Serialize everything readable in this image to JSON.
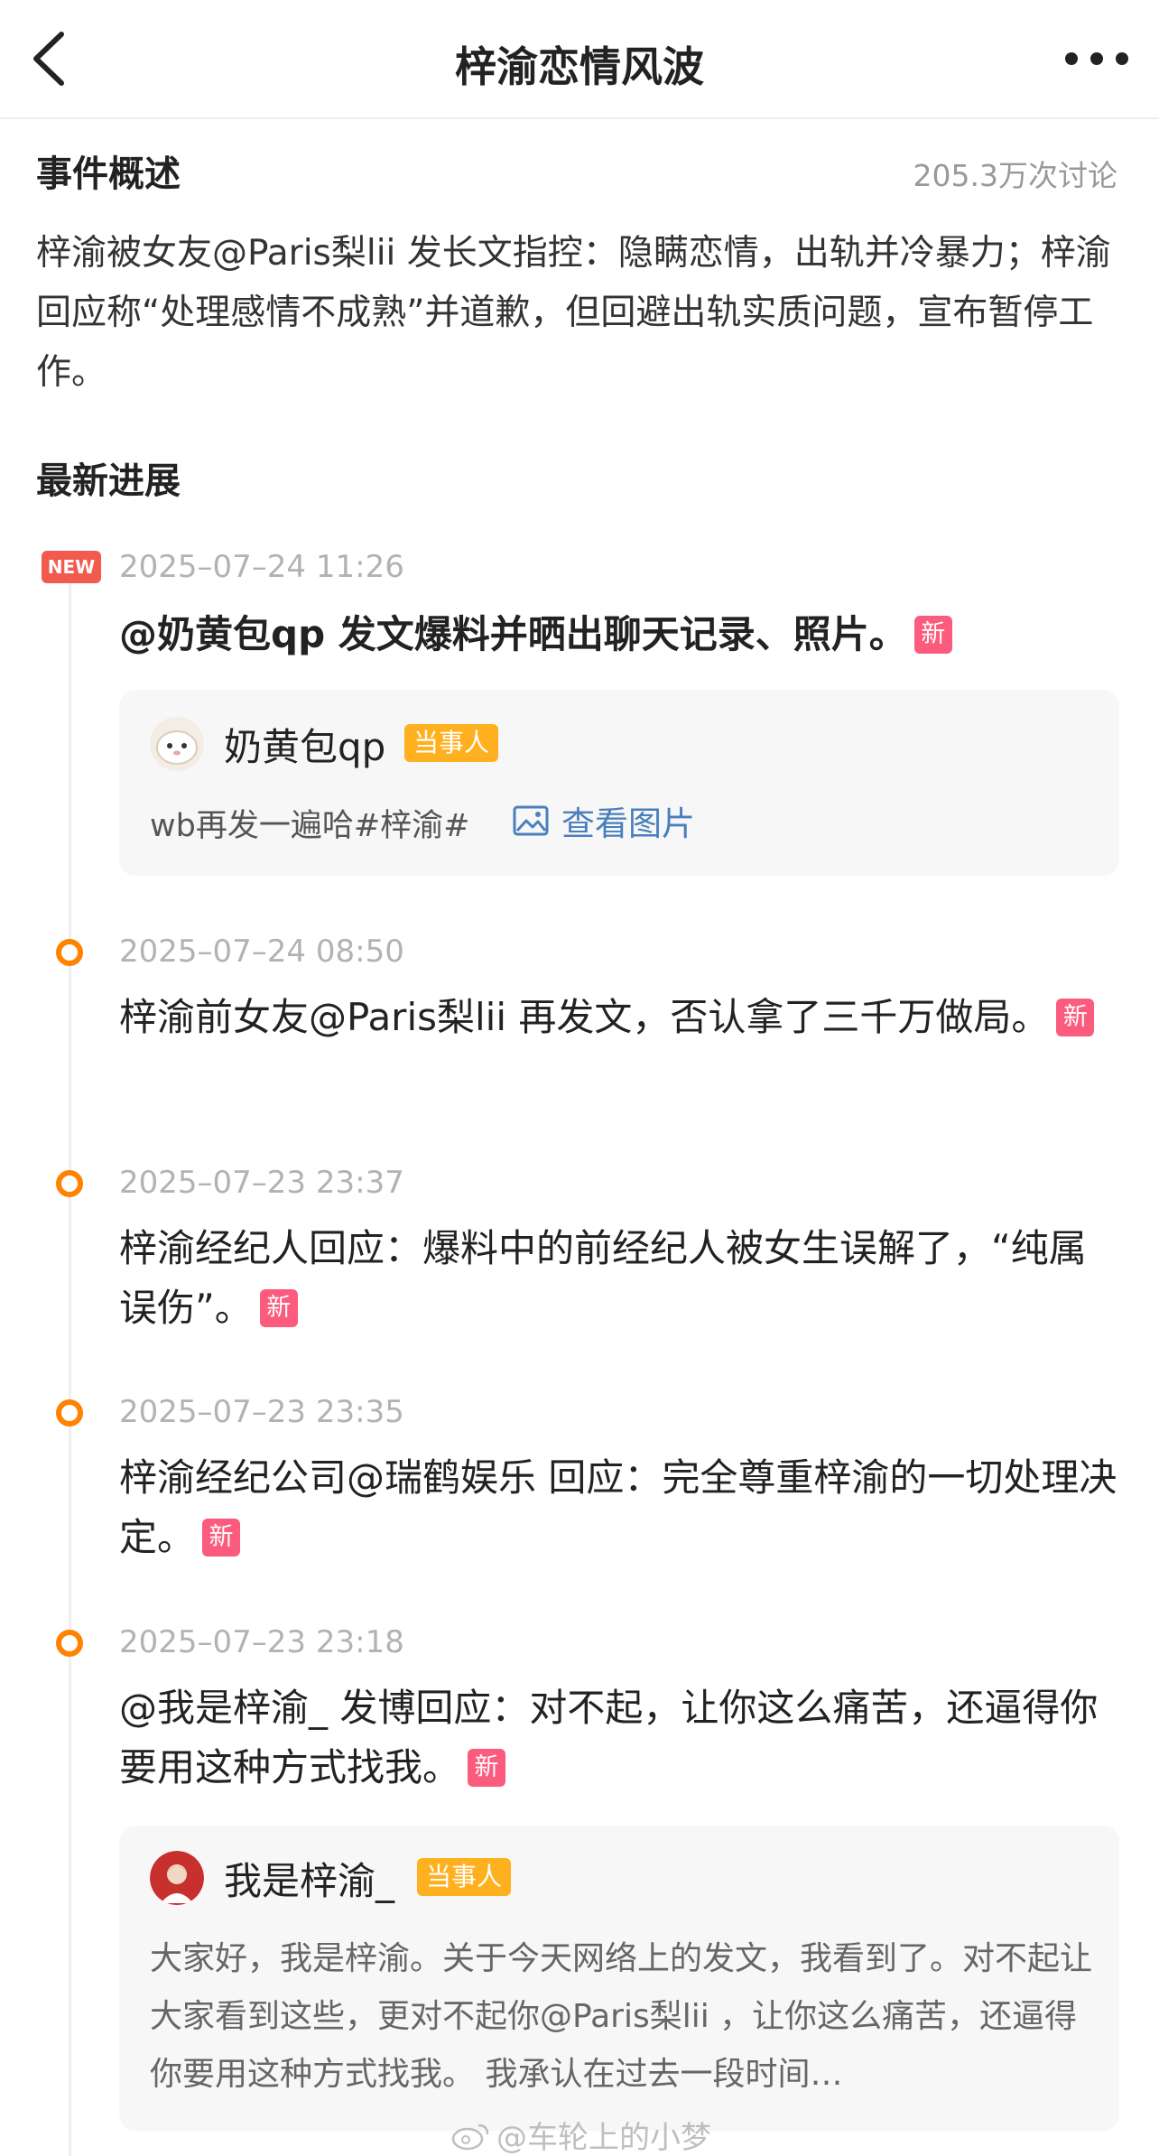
{
  "nav": {
    "title": "梓渝恋情风波"
  },
  "summary": {
    "heading": "事件概述",
    "discussion_count": "205.3万次讨论",
    "body": "梓渝被女友@Paris梨lii 发长文指控：隐瞒恋情，出轨并冷暴力；梓渝回应称“处理感情不成熟”并道歉，但回避出轨实质问题，宣布暂停工作。"
  },
  "progress": {
    "heading": "最新进展",
    "new_label": "NEW",
    "xin_label": "新",
    "entries": [
      {
        "time": "2025–07–24 11:26",
        "text": "@奶黄包qp 发文爆料并晒出聊天记录、照片。",
        "card": {
          "name": "奶黄包qp",
          "role": "当事人",
          "text": "wb再发一遍哈#梓渝#",
          "link": "查看图片"
        }
      },
      {
        "time": "2025–07–24 08:50",
        "text": "梓渝前女友@Paris梨lii 再发文，否认拿了三千万做局。"
      },
      {
        "time": "2025–07–23 23:37",
        "text": "梓渝经纪人回应：爆料中的前经纪人被女生误解了，“纯属误伤”。"
      },
      {
        "time": "2025–07–23 23:35",
        "text": "梓渝经纪公司@瑞鹤娱乐 回应：完全尊重梓渝的一切处理决定。"
      },
      {
        "time": "2025–07–23 23:18",
        "text": "@我是梓渝_ 发博回应：对不起，让你这么痛苦，还逼得你要用这种方式找我。",
        "card": {
          "name": "我是梓渝_",
          "role": "当事人",
          "text": "大家好，我是梓渝。关于今天网络上的发文，我看到了。对不起让大家看到这些，更对不起你@Paris梨lii ，让你这么痛苦，还逼得你要用这种方式找我。 我承认在过去一段时间…"
        }
      }
    ]
  },
  "watermark": "@车轮上的小梦",
  "colors": {
    "accent_orange": "#ff8200",
    "new_red": "#f25a4e",
    "xin_pink": "#fb5b7c",
    "role_yellow": "#ffb01f",
    "link_blue": "#4a7fbd"
  }
}
